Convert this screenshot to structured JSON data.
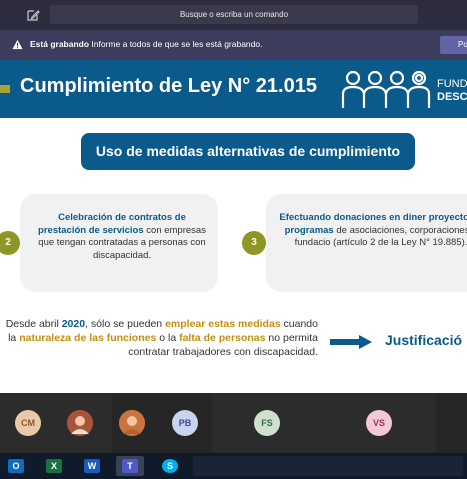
{
  "teams": {
    "search_placeholder": "Busque o escriba un comando",
    "recording": {
      "label": "Está grabando",
      "message": "Informe a todos de que se les está grabando.",
      "button_label": "Po"
    }
  },
  "slide": {
    "title": "Cumplimiento de Ley N° 21.015",
    "logo_line1": "FUND",
    "logo_line2": "DESC",
    "subtitle": "Uso de medidas alternativas de cumplimiento",
    "card1": {
      "number": "2",
      "bold_text": "Celebración de contratos de prestación de servicios",
      "text": "con empresas que tengan contratadas a personas con discapacidad."
    },
    "card2": {
      "number": "3",
      "bold_text": "Efectuando donaciones en diner proyectos o programas",
      "text": "de asociaciones, corporaciones o fundacio (artículo 2 de la Ley N° 19.885)."
    },
    "bottom": {
      "part1": "Desde abril ",
      "year": "2020",
      "part2": ", sólo se pueden ",
      "hl1": "emplear estas medidas",
      "part3": " cuando la ",
      "hl2": "naturaleza de las funciones",
      "part4": " o la ",
      "hl3": "falta de personas",
      "part5": " no permita contratar trabajadores con discapacidad."
    },
    "justification": "Justificació"
  },
  "participants": [
    {
      "initials": "CM",
      "bg": "#e8c9a8",
      "fg": "#8a5a2a"
    },
    {
      "initials": "",
      "bg": "#b35a3a",
      "fg": "#ffffff"
    },
    {
      "initials": "",
      "bg": "#c9753f",
      "fg": "#ffffff"
    },
    {
      "initials": "PB",
      "bg": "#c9d3f2",
      "fg": "#3b4a8a"
    },
    {
      "initials": "FS",
      "bg": "#cfe0d0",
      "fg": "#3a6a45"
    },
    {
      "initials": "VS",
      "bg": "#f4c9d6",
      "fg": "#9a3456"
    }
  ],
  "taskbar": {
    "apps": [
      {
        "name": "outlook",
        "letter": "O",
        "color": "#0f6cbd"
      },
      {
        "name": "excel",
        "letter": "X",
        "color": "#1d7044"
      },
      {
        "name": "word",
        "letter": "W",
        "color": "#185abd"
      },
      {
        "name": "teams",
        "letter": "T",
        "color": "#5059c9"
      },
      {
        "name": "skype",
        "letter": "S",
        "color": "#00aff0"
      }
    ]
  },
  "colors": {
    "brand_blue": "#0a5a8c",
    "accent_olive": "#8e9726",
    "highlight_gold": "#c28f10"
  }
}
